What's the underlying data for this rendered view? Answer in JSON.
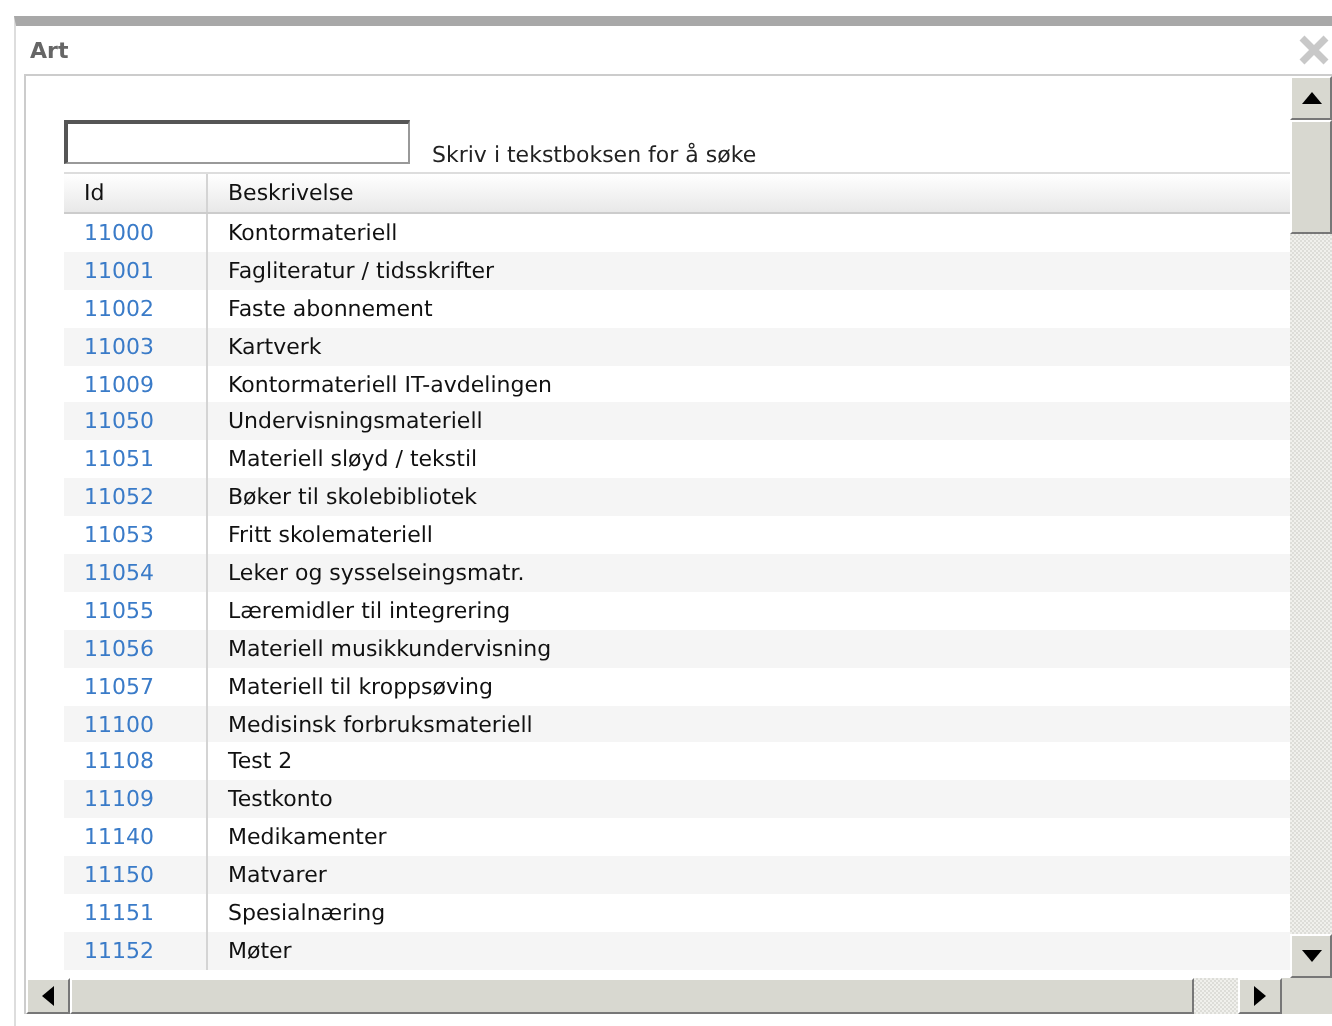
{
  "window": {
    "title": "Art"
  },
  "search": {
    "hint": "Skriv i tekstboksen for å søke"
  },
  "table": {
    "columns": [
      "Id",
      "Beskrivelse"
    ],
    "rows": [
      {
        "id": "11000",
        "text": "Kontormateriell"
      },
      {
        "id": "11001",
        "text": "Fagliteratur / tidsskrifter"
      },
      {
        "id": "11002",
        "text": "Faste abonnement"
      },
      {
        "id": "11003",
        "text": "Kartverk"
      },
      {
        "id": "11009",
        "text": "Kontormateriell IT-avdelingen"
      },
      {
        "id": "11050",
        "text": "Undervisningsmateriell"
      },
      {
        "id": "11051",
        "text": "Materiell sløyd / tekstil"
      },
      {
        "id": "11052",
        "text": "Bøker til skolebibliotek"
      },
      {
        "id": "11053",
        "text": "Fritt skolemateriell"
      },
      {
        "id": "11054",
        "text": "Leker og sysselseingsmatr."
      },
      {
        "id": "11055",
        "text": "Læremidler til integrering"
      },
      {
        "id": "11056",
        "text": "Materiell musikkundervisning"
      },
      {
        "id": "11057",
        "text": "Materiell til kroppsøving"
      },
      {
        "id": "11100",
        "text": "Medisinsk forbruksmateriell"
      },
      {
        "id": "11108",
        "text": "Test 2"
      },
      {
        "id": "11109",
        "text": "Testkonto"
      },
      {
        "id": "11140",
        "text": "Medikamenter"
      },
      {
        "id": "11150",
        "text": "Matvarer"
      },
      {
        "id": "11151",
        "text": "Spesialnæring"
      },
      {
        "id": "11152",
        "text": "Møter"
      }
    ]
  }
}
